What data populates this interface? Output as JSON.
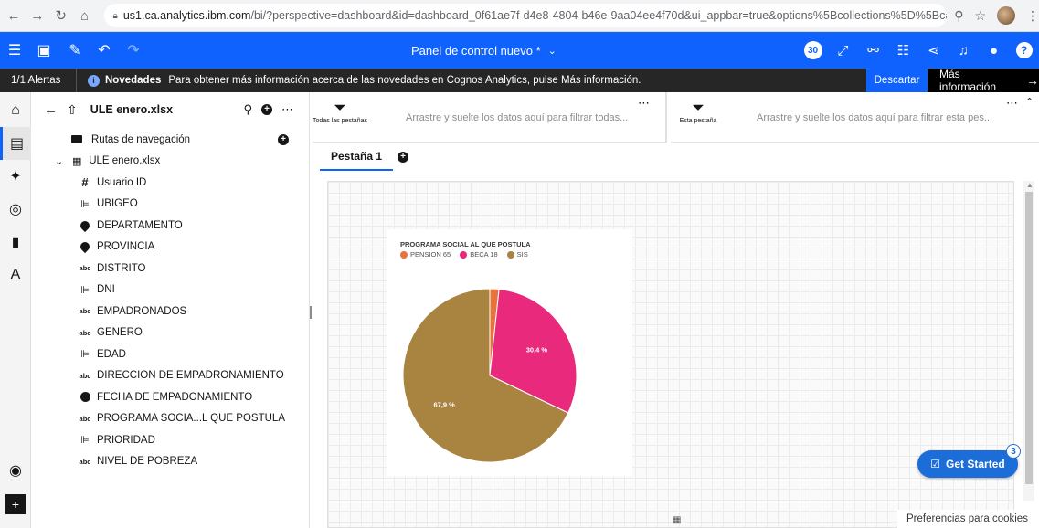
{
  "browser": {
    "url_host": "us1.ca.analytics.ibm.com",
    "url_path": "/bi/?perspective=dashboard&id=dashboard_0f61ae7f-d4e8-4804-b46e-9aa04ee4f70d&ui_appbar=true&options%5Bcollections%5D%5Bcanva..."
  },
  "appbar": {
    "title": "Panel de control nuevo *",
    "notification_count": "30",
    "help": "?"
  },
  "notification": {
    "alerts": "1/1 Alertas",
    "headline": "Novedades",
    "message": "Para obtener más información acerca de las novedades en Cognos Analytics, pulse Más información.",
    "dismiss": "Descartar",
    "more_info": "Más información"
  },
  "source_panel": {
    "file_name": "ULE enero.xlsx",
    "items": [
      {
        "icon": "folder-icon",
        "label": "Rutas de navegación",
        "level": 0
      },
      {
        "icon": "table-icon",
        "label": "ULE enero.xlsx",
        "level": 0
      },
      {
        "icon": "hash-icon",
        "label": "Usuario ID",
        "level": 1
      },
      {
        "icon": "measure-icon",
        "label": "UBIGEO",
        "level": 1
      },
      {
        "icon": "location-icon",
        "label": "DEPARTAMENTO",
        "level": 1
      },
      {
        "icon": "location-icon",
        "label": "PROVINCIA",
        "level": 1
      },
      {
        "icon": "text-icon",
        "label": "DISTRITO",
        "level": 1
      },
      {
        "icon": "measure-icon",
        "label": "DNI",
        "level": 1
      },
      {
        "icon": "text-icon",
        "label": "EMPADRONADOS",
        "level": 1
      },
      {
        "icon": "text-icon",
        "label": "GENERO",
        "level": 1
      },
      {
        "icon": "measure-icon",
        "label": "EDAD",
        "level": 1
      },
      {
        "icon": "text-icon",
        "label": "DIRECCION DE EMPADRONAMIENTO",
        "level": 1
      },
      {
        "icon": "clock-icon",
        "label": "FECHA DE EMPADONAMIENTO",
        "level": 1
      },
      {
        "icon": "text-icon",
        "label": "PROGRAMA SOCIA...L QUE POSTULA",
        "level": 1
      },
      {
        "icon": "measure-icon",
        "label": "PRIORIDAD",
        "level": 1
      },
      {
        "icon": "text-icon",
        "label": "NIVEL DE POBREZA",
        "level": 1
      }
    ]
  },
  "filters": {
    "all_tabs_caption": "Todas las pestañas",
    "all_tabs_hint": "Arrastre y suelte los datos aquí para filtrar todas...",
    "this_tab_caption": "Esta pestaña",
    "this_tab_hint": "Arrastre y suelte los datos aquí para filtrar esta pes..."
  },
  "tabs": [
    {
      "label": "Pestaña 1"
    }
  ],
  "get_started": {
    "label": "Get Started",
    "badge": "3"
  },
  "cookie_prefs": "Preferencias para cookies",
  "colors": {
    "accent": "#0f62fe",
    "pension": "#e8743b",
    "beca": "#e8297c",
    "sis": "#a88440"
  },
  "chart_data": {
    "type": "pie",
    "title": "PROGRAMA SOCIAL AL QUE POSTULA",
    "categories": [
      "PENSION 65",
      "BECA 18",
      "SIS"
    ],
    "values": [
      1.7,
      30.4,
      67.9
    ],
    "data_labels": [
      "",
      "30,4 %",
      "67,9 %"
    ],
    "legend": "top-left"
  }
}
